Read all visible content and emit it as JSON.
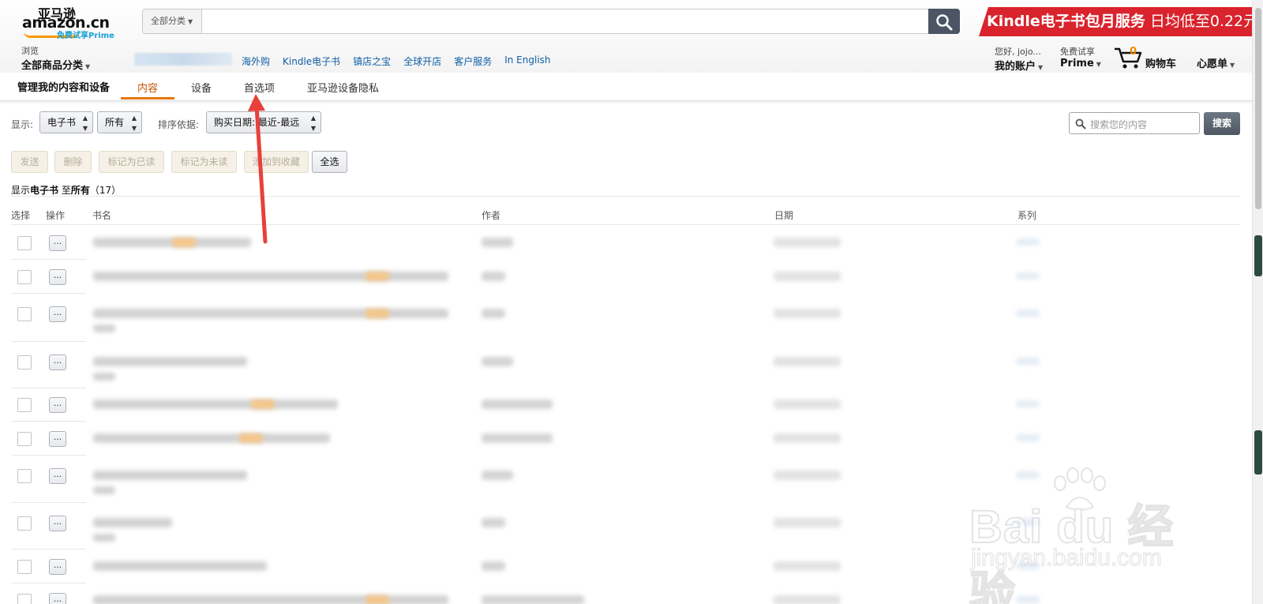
{
  "header": {
    "logo_cn": "亚马逊",
    "logo_en": "amazon.cn",
    "logo_prime": "免费试享Prime",
    "search_category": "全部分类",
    "banner_kindle": "Kindle电子书包月服务",
    "banner_price": "日均低至0.22元",
    "browse_small": "浏览",
    "browse_big": "全部商品分类",
    "nav_links": [
      "海外购",
      "Kindle电子书",
      "镇店之宝",
      "全球开店",
      "客户服务",
      "In English"
    ],
    "account_small": "您好, jojo...",
    "account_big": "我的账户",
    "prime_small": "免费试享",
    "prime_big": "Prime",
    "cart_count": "0",
    "cart_label": "购物车",
    "wishlist": "心愿单"
  },
  "subnav": {
    "title": "管理我的内容和设备",
    "tabs": [
      "内容",
      "设备",
      "首选项",
      "亚马逊设备隐私"
    ],
    "active_tab": "内容"
  },
  "filters": {
    "show_label": "显示:",
    "type_value": "电子书",
    "scope_value": "所有",
    "sort_label": "排序依据:",
    "sort_value": "购买日期: 最近-最远",
    "search_placeholder": "搜索您的内容",
    "search_button": "搜索"
  },
  "actions": {
    "send": "发送",
    "delete": "删除",
    "mark_read": "标记为已读",
    "mark_unread": "标记为未读",
    "add_collection": "添加到收藏",
    "select_all": "全选"
  },
  "summary": {
    "prefix": "显示",
    "type": "电子书",
    "middle": " 至",
    "scope": "所有",
    "count": "（17）"
  },
  "table": {
    "columns": [
      "选择",
      "操作",
      "书名",
      "作者",
      "日期",
      "系列"
    ],
    "row_action_label": "...",
    "row_count_visible": 11
  },
  "watermark": {
    "brand": "Bai du 经验",
    "url": "jingyan.baidu.com"
  },
  "colors": {
    "accent_orange": "#e77600",
    "link_blue": "#0f5fa6",
    "banner_red": "#d9232d",
    "annotation_arrow": "#e8403a"
  }
}
